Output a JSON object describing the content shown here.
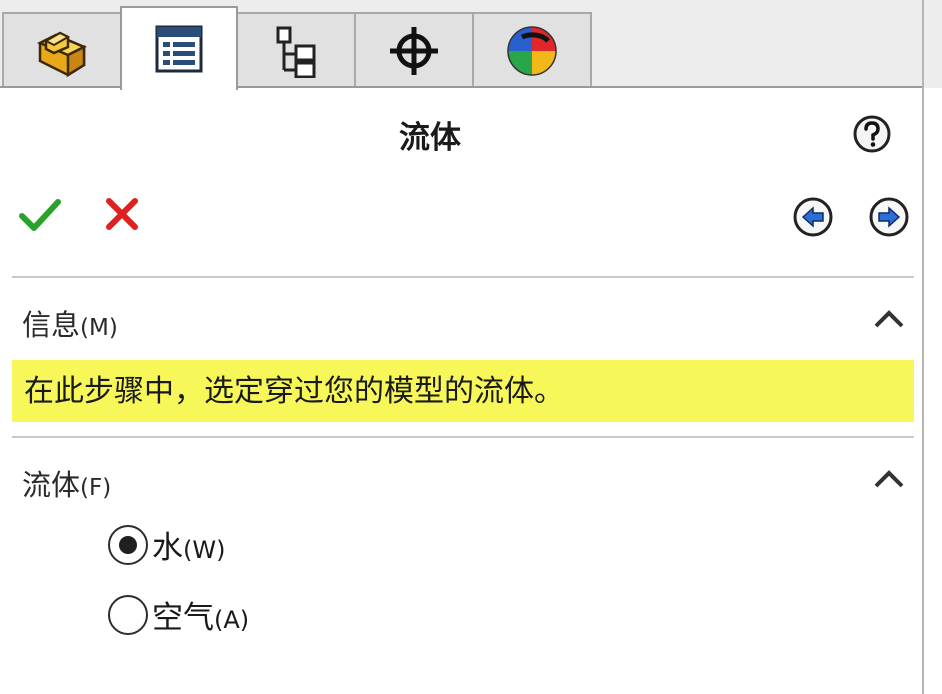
{
  "tabs": [
    {
      "name": "feature-manager",
      "icon": "part-feature-icon",
      "active": false
    },
    {
      "name": "property-manager",
      "icon": "property-manager-icon",
      "active": true
    },
    {
      "name": "configuration-manager",
      "icon": "configuration-tree-icon",
      "active": false
    },
    {
      "name": "dimxpert-manager",
      "icon": "crosshair-icon",
      "active": false
    },
    {
      "name": "display-manager",
      "icon": "color-wheel-icon",
      "active": false
    }
  ],
  "header": {
    "title": "流体"
  },
  "sections": {
    "info": {
      "title": "信息",
      "key": "(M)",
      "message": "在此步骤中，选定穿过您的模型的流体。"
    },
    "fluid": {
      "title": "流体",
      "key": "(F)",
      "options": [
        {
          "label": "水",
          "key": "(W)",
          "checked": true
        },
        {
          "label": "空气",
          "key": "(A)",
          "checked": false
        }
      ]
    }
  },
  "colors": {
    "ok": "#2aa12a",
    "cancel": "#e0201f",
    "highlight": "#f7f75a",
    "nav_blue": "#2b6fd6"
  }
}
